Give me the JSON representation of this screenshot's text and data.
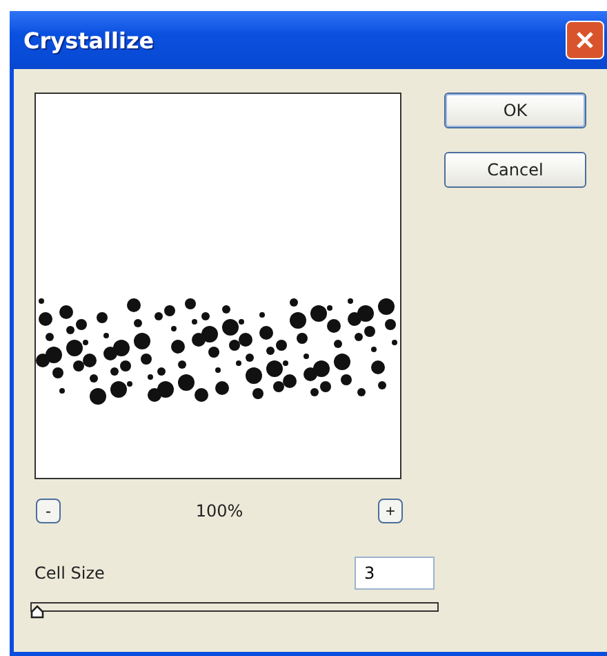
{
  "window": {
    "title": "Crystallize"
  },
  "buttons": [
    {
      "label": "OK",
      "default": true
    },
    {
      "label": "Cancel",
      "default": false
    }
  ],
  "zoom": {
    "minus": "-",
    "value": "100%",
    "plus": "+"
  },
  "cell_size": {
    "label": "Cell Size",
    "value": "3",
    "level": 0
  }
}
